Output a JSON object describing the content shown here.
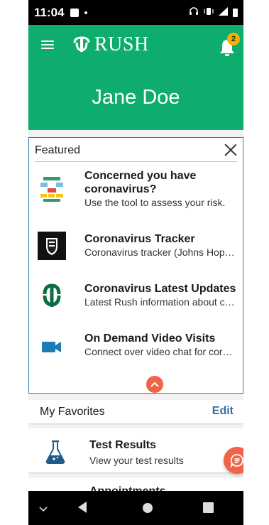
{
  "status_bar": {
    "time": "11:04",
    "icons": [
      "image-icon",
      "dot-icon",
      "headphones-icon",
      "vibrate-icon",
      "lte-signal-icon",
      "battery-icon"
    ]
  },
  "header": {
    "brand": "RUSH",
    "user_name": "Jane Doe",
    "notification_count": "2",
    "background_color": "#0ead6d"
  },
  "featured": {
    "title": "Featured",
    "items": [
      {
        "title": "Concerned you have coronavirus?",
        "subtitle": "Use the tool to assess your risk.",
        "icon": "flowchart-icon"
      },
      {
        "title": "Coronavirus Tracker",
        "subtitle": "Coronavirus tracker (Johns Hopkins)",
        "icon": "johns-hopkins-shield-icon"
      },
      {
        "title": "Coronavirus Latest Updates",
        "subtitle": "Latest Rush information about coronavirus",
        "icon": "rush-logo-icon"
      },
      {
        "title": "On Demand Video Visits",
        "subtitle": "Connect over video chat for coronavirus",
        "icon": "video-camera-icon"
      }
    ]
  },
  "favorites": {
    "title": "My Favorites",
    "edit_label": "Edit",
    "items": [
      {
        "title": "Test Results",
        "subtitle": "View your test results",
        "icon": "flask-icon"
      },
      {
        "title": "Appointments",
        "subtitle": "",
        "icon": "calendar-icon"
      }
    ]
  },
  "colors": {
    "accent": "#ef6449",
    "link": "#2e6ea6",
    "featured_border": "#2e78a8"
  }
}
